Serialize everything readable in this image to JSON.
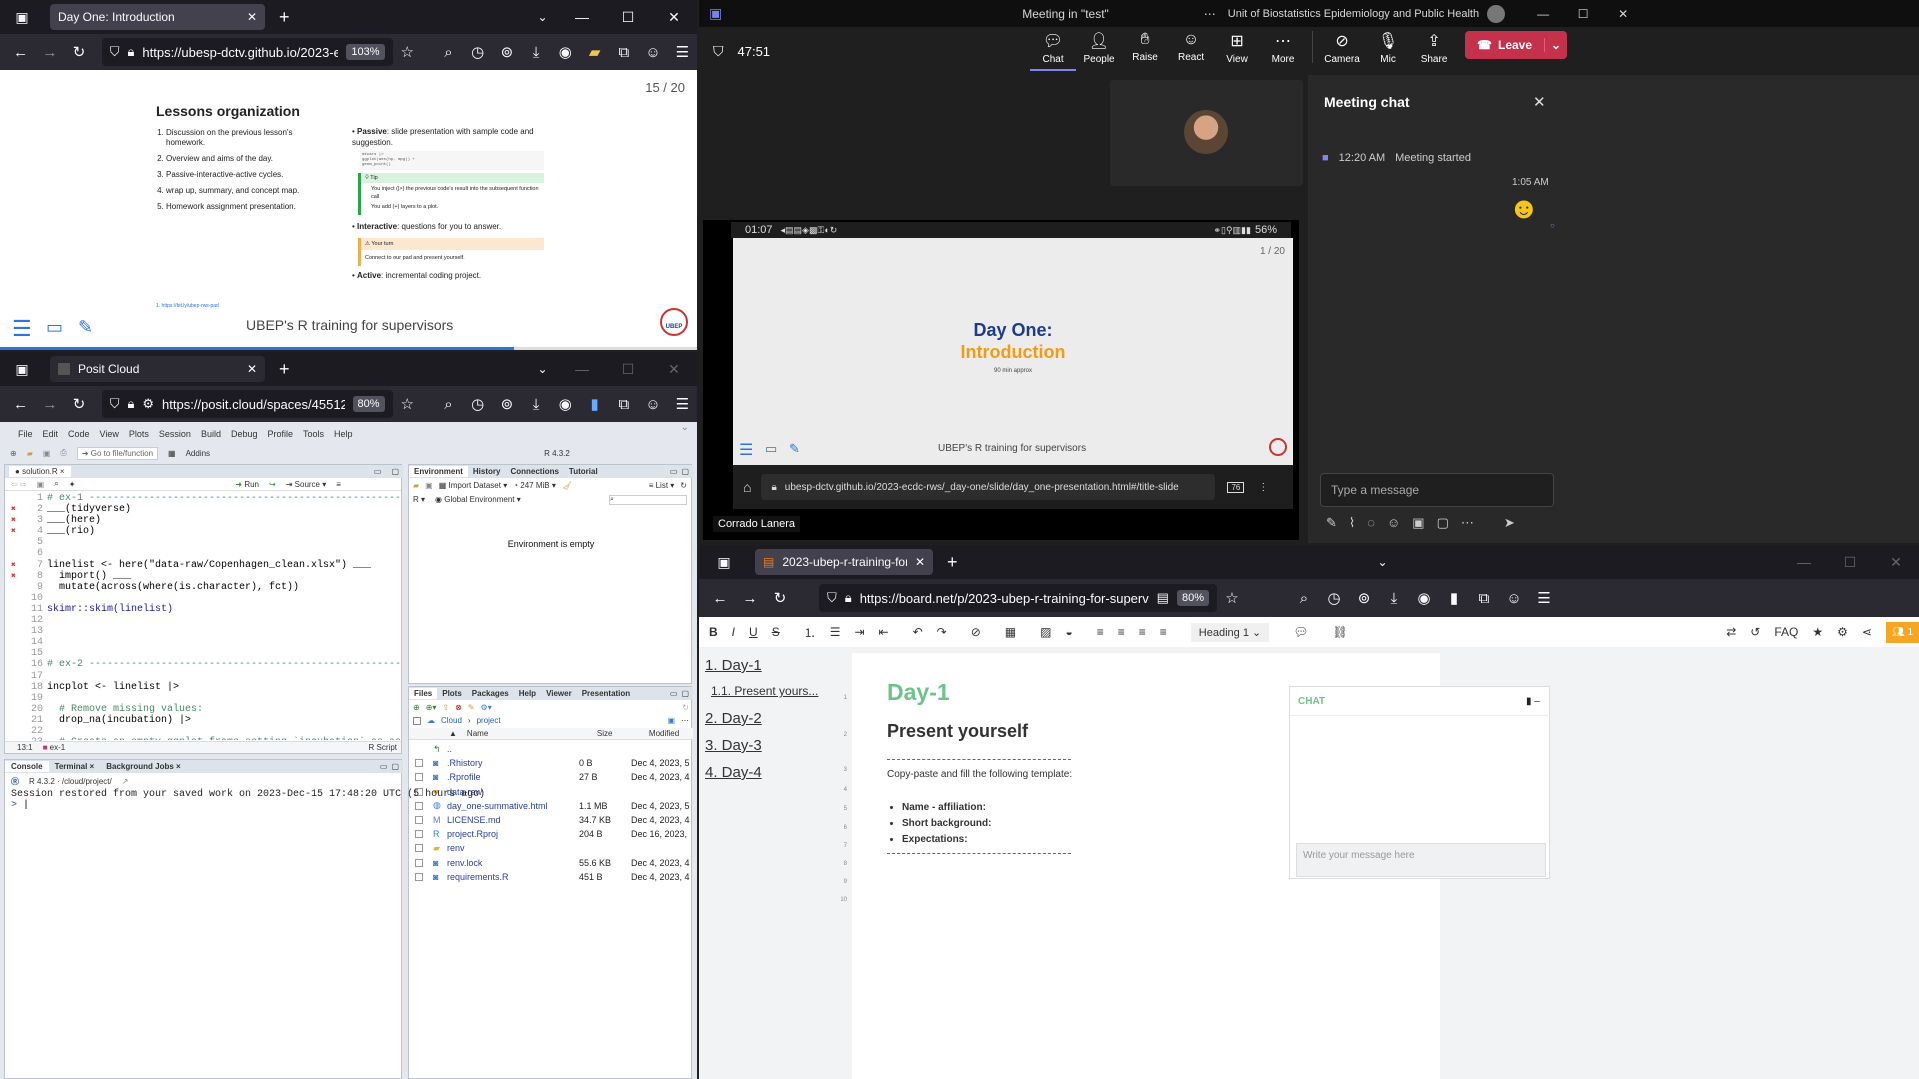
{
  "win1": {
    "tab_title": "Day One: Introduction",
    "url": "https://ubesp-dctv.github.io/2023-e",
    "zoom": "103%",
    "slide_counter": "15 / 20",
    "slide_title": "Lessons organization",
    "list": [
      "Discussion on the previous lesson's homework.",
      "Overview and aims of the day.",
      "Passive-interactive-active cycles.",
      "wrap up, summary, and concept map.",
      "Homework assignment presentation."
    ],
    "passive_bold": "Passive",
    "passive_text": ": slide presentation with sample code and suggestion.",
    "mini_code": [
      "mtcars |>",
      "  ggplot(aes(hp, mpg)) +",
      "  geom_point()"
    ],
    "tip_title": "Tip",
    "tip_items": [
      "You inject (|>) the previous code's result into the subsequent function call",
      "You add (+) layers to a plot."
    ],
    "interactive_bold": "Interactive",
    "interactive_text": ": questions for you to answer.",
    "yourturn_title": "Your turn",
    "yourturn_text": "Connect to our pad and present yourself.",
    "active_bold": "Active",
    "active_text": ": incremental coding project.",
    "footnote": "1. https://bit.ly/ubep-rws-pad",
    "footer": "UBEP's R training for supervisors",
    "logo_text": "UBEP"
  },
  "win2": {
    "tab_title": "Posit Cloud",
    "url": "https://posit.cloud/spaces/45512",
    "zoom": "80%",
    "menu": [
      "File",
      "Edit",
      "Code",
      "View",
      "Plots",
      "Session",
      "Build",
      "Debug",
      "Profile",
      "Tools",
      "Help"
    ],
    "goto": "Go to file/function",
    "addins": "Addins",
    "rversion": "R 4.3.2",
    "editor_tab": "solution.R",
    "run": "Run",
    "source": "Source",
    "code_lines": [
      "# ex-1 -----------------------------------------------------------------------",
      "___(tidyverse)",
      "___(here)",
      "___(rio)",
      "",
      "",
      "linelist <- here(\"data-raw/Copenhagen_clean.xlsx\") ___",
      "  import() ___",
      "  mutate(across(where(is.character), fct))",
      "",
      "skimr::skim(linelist)",
      "",
      "",
      "",
      "",
      "# ex-2 -----------------------------------------------------------------------",
      "",
      "incplot <- linelist |>",
      "",
      "  # Remove missing values:",
      "  drop_na(incubation) |>",
      "",
      "  # Create an empty ggplot frame setting `incubation` as aesthetic:"
    ],
    "cursor_pos": "13:1",
    "scope": "ex-1",
    "filetype": "R Script",
    "env_tabs": [
      "Environment",
      "History",
      "Connections",
      "Tutorial"
    ],
    "import_dataset": "Import Dataset",
    "memory": "247 MiB",
    "list_label": "List",
    "r_label": "R",
    "global_env": "Global Environment",
    "env_empty": "Environment is empty",
    "files_tabs": [
      "Files",
      "Plots",
      "Packages",
      "Help",
      "Viewer",
      "Presentation"
    ],
    "path": [
      "Cloud",
      "project"
    ],
    "file_headers": [
      "Name",
      "Size",
      "Modified"
    ],
    "files": [
      {
        "name": "..",
        "size": "",
        "mod": "",
        "icon": "up"
      },
      {
        "name": ".Rhistory",
        "size": "0 B",
        "mod": "Dec 4, 2023, 5",
        "icon": "doc"
      },
      {
        "name": ".Rprofile",
        "size": "27 B",
        "mod": "Dec 4, 2023, 4",
        "icon": "doc"
      },
      {
        "name": "data-raw",
        "size": "",
        "mod": "",
        "icon": "folder"
      },
      {
        "name": "day_one-summative.html",
        "size": "1.1 MB",
        "mod": "Dec 4, 2023, 5",
        "icon": "web"
      },
      {
        "name": "LICENSE.md",
        "size": "34.7 KB",
        "mod": "Dec 4, 2023, 4",
        "icon": "md"
      },
      {
        "name": "project.Rproj",
        "size": "204 B",
        "mod": "Dec 16, 2023,",
        "icon": "rproj"
      },
      {
        "name": "renv",
        "size": "",
        "mod": "",
        "icon": "folder"
      },
      {
        "name": "renv.lock",
        "size": "55.6 KB",
        "mod": "Dec 4, 2023, 4",
        "icon": "doc"
      },
      {
        "name": "requirements.R",
        "size": "451 B",
        "mod": "Dec 4, 2023, 4",
        "icon": "doc"
      }
    ],
    "console_tabs": [
      "Console",
      "Terminal",
      "Background Jobs"
    ],
    "console_path": "R 4.3.2 · /cloud/project/",
    "console_text": "Session restored from your saved work on 2023-Dec-15 17:48:20 UTC (5 hours ago)",
    "prompt": ">"
  },
  "teams": {
    "title": "Meeting in \"test\"",
    "org": "Unit of Biostatistics Epidemiology and Public Health",
    "timer": "47:51",
    "buttons": [
      "Chat",
      "People",
      "Raise",
      "React",
      "View",
      "More",
      "Camera",
      "Mic",
      "Share"
    ],
    "leave": "Leave",
    "chat_title": "Meeting chat",
    "event_time": "12:20 AM",
    "event_text": "Meeting started",
    "msg_time": "1:05 AM",
    "input_placeholder": "Type a message",
    "presenter": "Corrado Lanera",
    "phone_time": "01:07",
    "phone_battery": "56%",
    "slide_counter": "1 / 20",
    "slide_title1": "Day One:",
    "slide_title2": "Introduction",
    "slide_sub": "90 min approx",
    "slide_footer": "UBEP's R training for supervisors",
    "phone_url": "ubesp-dctv.github.io/2023-ecdc-rws/_day-one/slide/day_one-presentation.html#/title-slide",
    "phone_tabs": "76"
  },
  "win3": {
    "tab_title": "2023-ubep-r-training-for-super",
    "url": "https://board.net/p/2023-ubep-r-training-for-supervisors",
    "zoom": "80%",
    "heading_sel": "Heading 1",
    "faq": "FAQ",
    "users": "1",
    "toc": [
      "1. Day-1",
      "1.1. Present yours...",
      "2. Day-2",
      "3. Day-3",
      "4. Day-4"
    ],
    "h1": "Day-1",
    "h2": "Present yourself",
    "para": "Copy-paste and fill the following template:",
    "bullets": [
      "Name - affiliation",
      "Short background",
      "Expectations"
    ],
    "line_nums": [
      "1",
      "2",
      "3",
      "4",
      "5",
      "6",
      "7",
      "8",
      "9",
      "10"
    ],
    "chat_label": "CHAT",
    "chat_placeholder": "Write your message here"
  }
}
